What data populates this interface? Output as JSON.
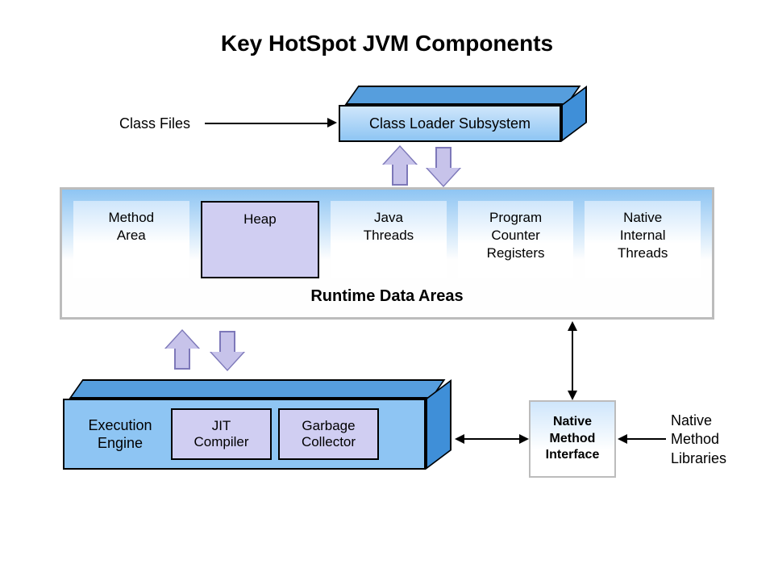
{
  "title": "Key HotSpot JVM Components",
  "class_files_label": "Class Files",
  "class_loader": {
    "label": "Class Loader Subsystem"
  },
  "runtime_data_areas": {
    "title": "Runtime Data Areas",
    "cells": [
      {
        "label": "Method\nArea"
      },
      {
        "label": "Heap",
        "highlighted": true
      },
      {
        "label": "Java\nThreads"
      },
      {
        "label": "Program\nCounter\nRegisters"
      },
      {
        "label": "Native\nInternal\nThreads"
      }
    ]
  },
  "execution_engine": {
    "label": "Execution\nEngine",
    "sub": [
      {
        "label": "JIT\nCompiler"
      },
      {
        "label": "Garbage\nCollector"
      }
    ]
  },
  "native_method_interface": {
    "label": "Native\nMethod\nInterface"
  },
  "native_method_libraries_label": "Native\nMethod\nLibraries"
}
